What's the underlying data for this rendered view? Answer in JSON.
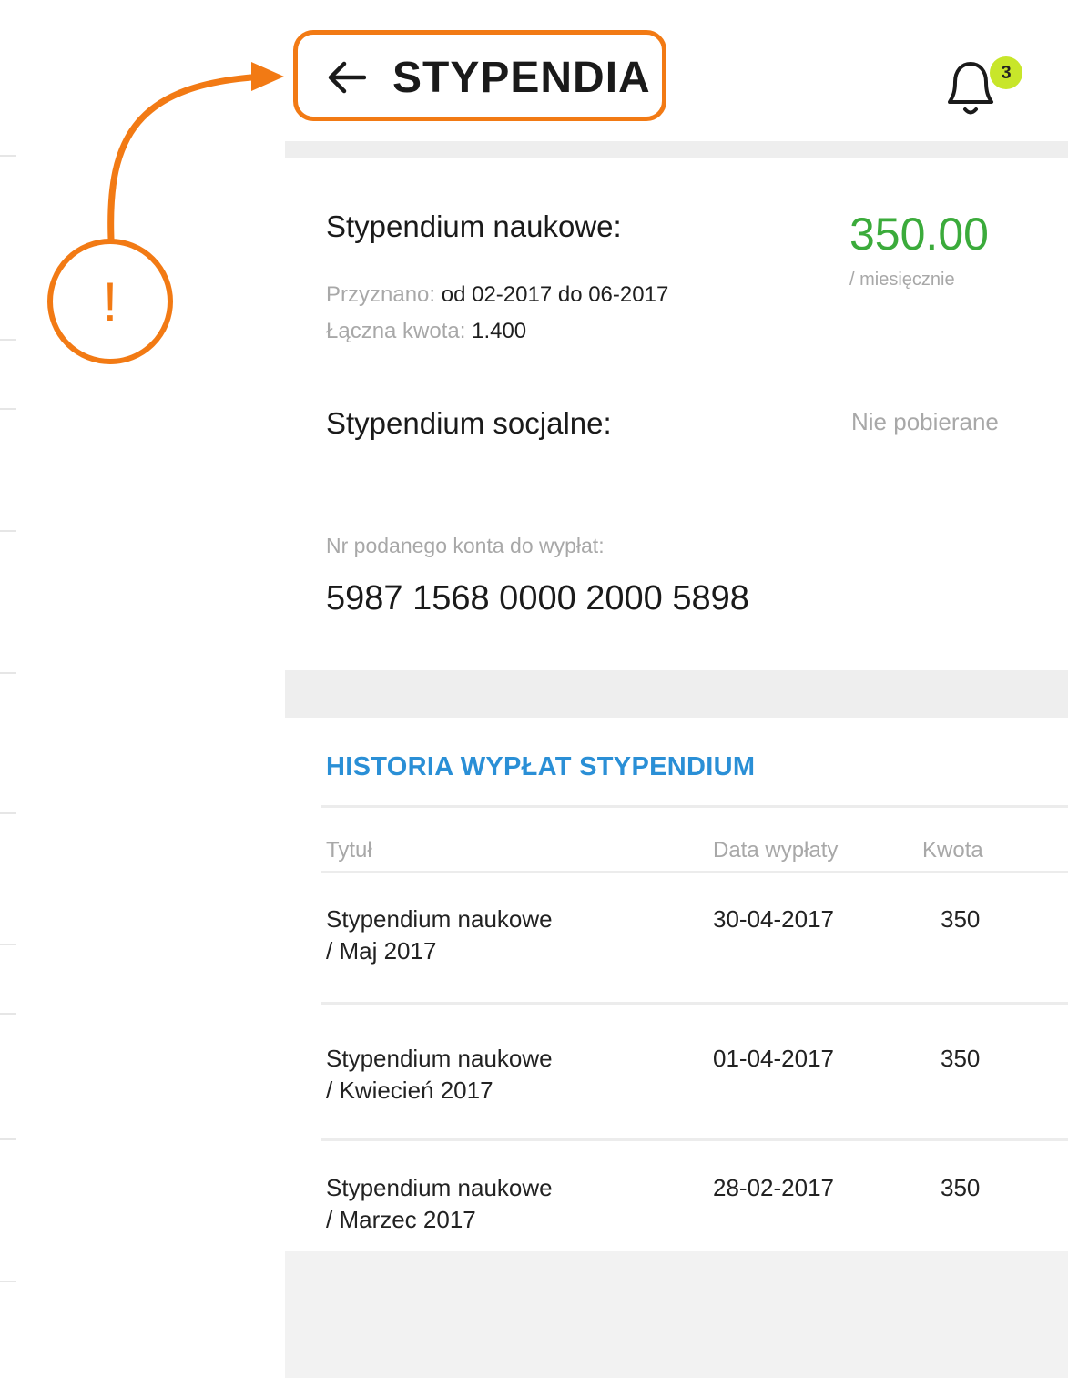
{
  "header": {
    "title": "STYPENDIA",
    "notification_count": "3"
  },
  "scholarship_scientific": {
    "label": "Stypendium naukowe:",
    "amount": "350.00",
    "period": "/ miesięcznie",
    "granted_label": "Przyznano:",
    "granted_value": "od 02-2017 do 06-2017",
    "total_label": "Łączna kwota:",
    "total_value": "1.400"
  },
  "scholarship_social": {
    "label": "Stypendium socjalne:",
    "status": "Nie pobierane"
  },
  "account": {
    "label": "Nr podanego konta do wypłat:",
    "number": "5987 1568 0000 2000 5898"
  },
  "history": {
    "title": "HISTORIA WYPŁAT STYPENDIUM",
    "columns": [
      "Tytuł",
      "Data wypłaty",
      "Kwota"
    ],
    "rows": [
      {
        "title_line1": "Stypendium naukowe",
        "title_line2": "/ Maj 2017",
        "date": "30-04-2017",
        "amount": "350"
      },
      {
        "title_line1": "Stypendium naukowe",
        "title_line2": "/ Kwiecień 2017",
        "date": "01-04-2017",
        "amount": "350"
      },
      {
        "title_line1": "Stypendium naukowe",
        "title_line2": "/ Marzec 2017",
        "date": "28-02-2017",
        "amount": "350"
      }
    ]
  },
  "callout": {
    "mark": "!"
  },
  "colors": {
    "accent_orange": "#f27a14",
    "amount_green": "#3bab3b",
    "link_blue": "#2a8fd6",
    "badge_lime": "#c8e62a"
  },
  "icons": [
    "back-arrow-icon",
    "bell-icon"
  ]
}
